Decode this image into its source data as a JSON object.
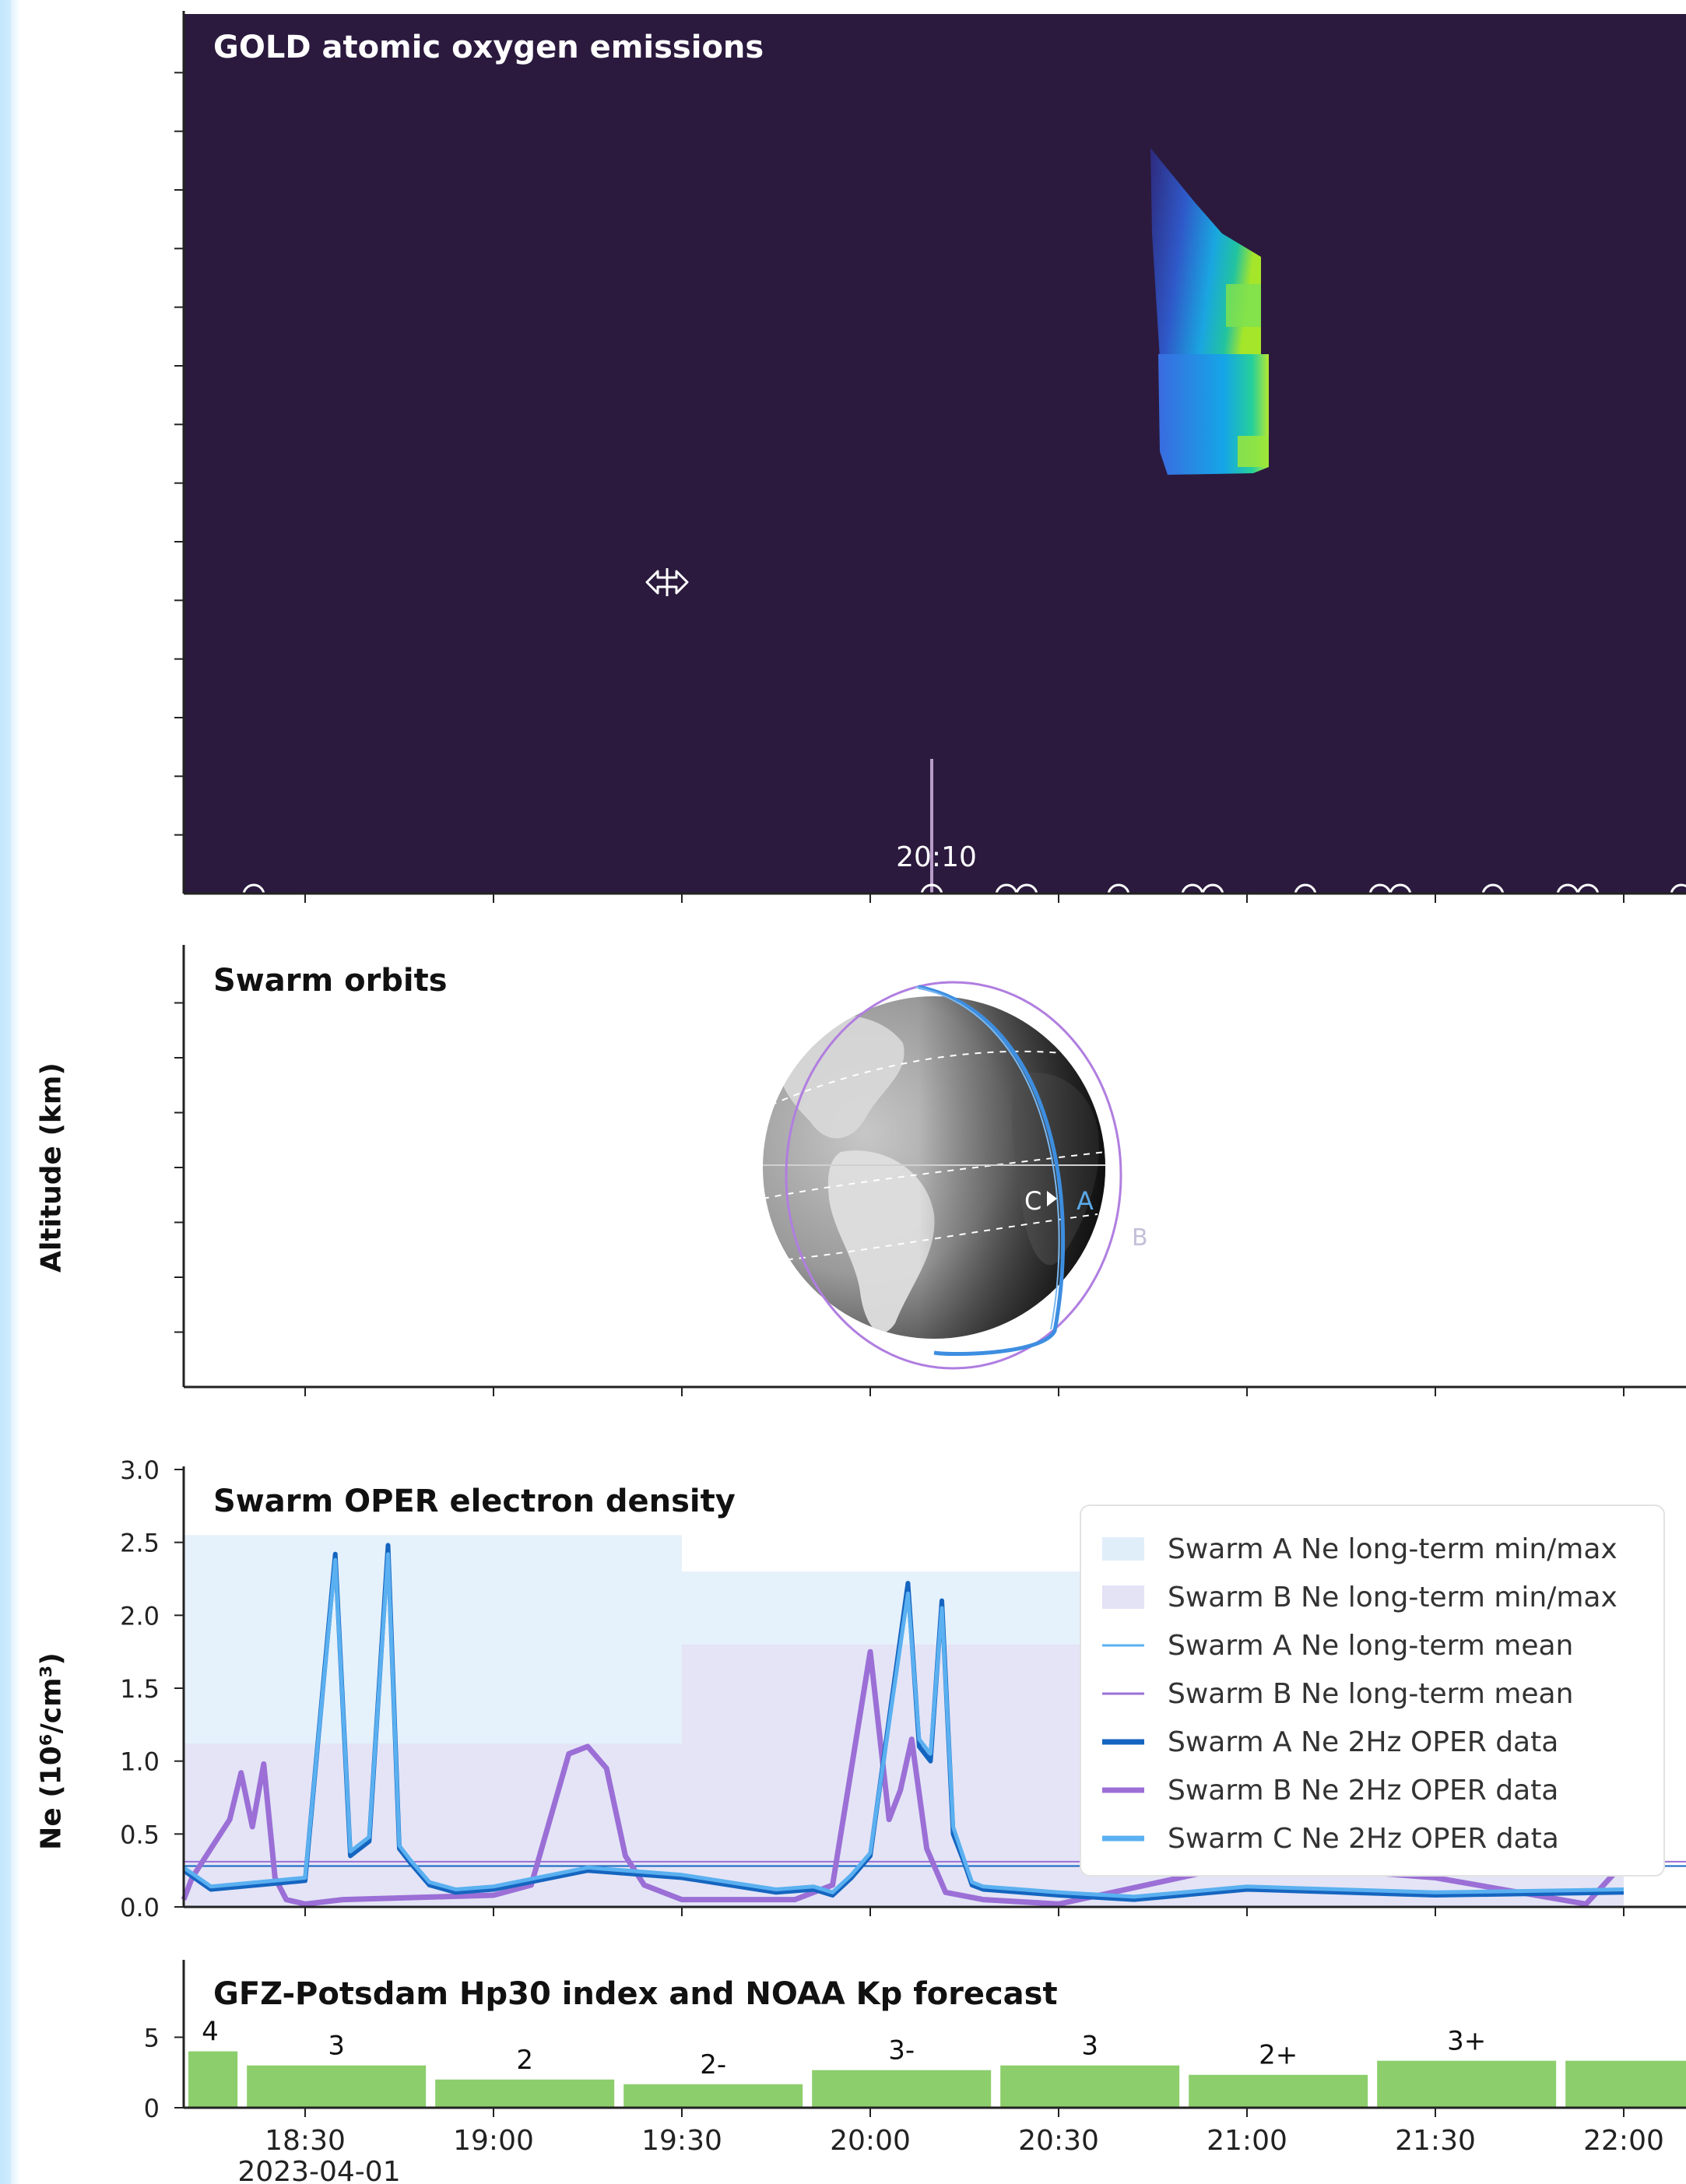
{
  "panels": {
    "gold": {
      "title": "GOLD atomic oxygen emissions",
      "cursor_time": "20:10"
    },
    "orbits": {
      "title": "Swarm orbits",
      "ylabel": "Altitude (km)",
      "sat_labels": [
        "C",
        "A",
        "B"
      ]
    },
    "ne": {
      "title": "Swarm OPER electron density",
      "ylabel": "Ne (10⁶/cm³)"
    },
    "hp": {
      "title": "GFZ-Potsdam Hp30 index and NOAA Kp forecast"
    }
  },
  "time_axis": {
    "ticks": [
      "18:30",
      "19:00",
      "19:30",
      "20:00",
      "20:30",
      "21:00",
      "21:30",
      "22:00"
    ],
    "date_label": "2023-04-01"
  },
  "colors": {
    "gold_bg": "#2b1a3e",
    "swarm_a": "#1565c0",
    "swarm_b": "#9b6fd6",
    "swarm_c": "#5ab0f0",
    "band_a": "#e0eefa",
    "band_b": "#e4e2f5",
    "hp_bar": "#8cce6c"
  },
  "chart_data": [
    {
      "type": "heatmap",
      "title": "GOLD atomic oxygen emissions",
      "colormap": "viridis",
      "background": "#2b1a3e"
    },
    {
      "type": "line",
      "title": "Swarm OPER electron density",
      "ylabel": "Ne (10⁶/cm³)",
      "ylim": [
        0,
        3.0
      ],
      "yticks": [
        "0.0",
        "0.5",
        "1.0",
        "1.5",
        "2.0",
        "2.5",
        "3.0"
      ],
      "x_hours": [
        18.083,
        19.5,
        22.0
      ],
      "bands": [
        {
          "name": "Swarm A Ne long-term min/max",
          "segments": [
            {
              "x0": 18.083,
              "x1": 19.5,
              "min": 0.0,
              "max": 2.55
            },
            {
              "x0": 19.5,
              "x1": 22.0,
              "min": 0.0,
              "max": 2.3
            }
          ]
        },
        {
          "name": "Swarm B Ne long-term min/max",
          "segments": [
            {
              "x0": 18.083,
              "x1": 19.5,
              "min": 0.0,
              "max": 1.12
            },
            {
              "x0": 19.5,
              "x1": 22.0,
              "min": 0.0,
              "max": 1.8
            }
          ]
        }
      ],
      "mean_lines": [
        {
          "name": "Swarm A Ne long-term mean",
          "value": 0.28
        },
        {
          "name": "Swarm B Ne long-term mean",
          "value": 0.31
        }
      ],
      "series": [
        {
          "name": "Swarm A Ne 2Hz OPER data",
          "color_key": "swarm_a",
          "x": [
            18.083,
            18.25,
            18.5,
            18.58,
            18.62,
            18.67,
            18.72,
            18.75,
            18.78,
            18.83,
            18.9,
            19.0,
            19.25,
            19.5,
            19.75,
            19.85,
            19.9,
            19.95,
            20.0,
            20.1,
            20.13,
            20.16,
            20.19,
            20.22,
            20.25,
            20.27,
            20.3,
            20.4,
            20.5,
            20.7,
            21.0,
            21.5,
            22.0
          ],
          "y": [
            0.25,
            0.12,
            0.18,
            2.42,
            0.35,
            0.45,
            2.48,
            0.4,
            0.3,
            0.15,
            0.1,
            0.12,
            0.25,
            0.2,
            0.1,
            0.12,
            0.08,
            0.2,
            0.35,
            2.22,
            1.1,
            1.0,
            2.1,
            0.5,
            0.3,
            0.15,
            0.12,
            0.1,
            0.08,
            0.05,
            0.12,
            0.08,
            0.1
          ]
        },
        {
          "name": "Swarm B Ne 2Hz OPER data",
          "color_key": "swarm_b",
          "x": [
            18.083,
            18.2,
            18.3,
            18.33,
            18.36,
            18.39,
            18.42,
            18.45,
            18.5,
            18.6,
            19.0,
            19.1,
            19.2,
            19.25,
            19.3,
            19.35,
            19.4,
            19.5,
            19.8,
            19.9,
            20.0,
            20.05,
            20.08,
            20.11,
            20.15,
            20.2,
            20.3,
            20.5,
            21.0,
            21.5,
            21.9,
            22.0
          ],
          "y": [
            0.05,
            0.2,
            0.6,
            0.92,
            0.55,
            0.98,
            0.2,
            0.05,
            0.02,
            0.05,
            0.08,
            0.15,
            1.05,
            1.1,
            0.95,
            0.35,
            0.15,
            0.05,
            0.05,
            0.15,
            1.75,
            0.6,
            0.8,
            1.15,
            0.4,
            0.1,
            0.05,
            0.02,
            0.3,
            0.2,
            0.02,
            0.3
          ]
        },
        {
          "name": "Swarm C Ne 2Hz OPER data",
          "color_key": "swarm_c",
          "x": [
            18.083,
            18.25,
            18.5,
            18.58,
            18.62,
            18.67,
            18.72,
            18.75,
            18.78,
            18.83,
            18.9,
            19.0,
            19.25,
            19.5,
            19.75,
            19.85,
            19.9,
            19.95,
            20.0,
            20.1,
            20.13,
            20.16,
            20.19,
            20.22,
            20.25,
            20.27,
            20.3,
            20.4,
            20.5,
            20.7,
            21.0,
            21.5,
            22.0
          ],
          "y": [
            0.27,
            0.14,
            0.2,
            2.38,
            0.38,
            0.48,
            2.42,
            0.42,
            0.32,
            0.17,
            0.12,
            0.14,
            0.27,
            0.22,
            0.12,
            0.14,
            0.1,
            0.22,
            0.37,
            2.15,
            1.15,
            1.05,
            2.05,
            0.55,
            0.32,
            0.17,
            0.14,
            0.12,
            0.1,
            0.07,
            0.14,
            0.1,
            0.12
          ]
        }
      ],
      "legend": {
        "placement": "top-right",
        "entries": [
          {
            "label": "Swarm A Ne long-term min/max",
            "kind": "box",
            "color_key": "band_a"
          },
          {
            "label": "Swarm B Ne long-term min/max",
            "kind": "box",
            "color_key": "band_b"
          },
          {
            "label": "Swarm A Ne long-term mean",
            "kind": "thin",
            "color_key": "swarm_c"
          },
          {
            "label": "Swarm B Ne long-term mean",
            "kind": "thin",
            "color_key": "swarm_b"
          },
          {
            "label": "Swarm A Ne 2Hz OPER data",
            "kind": "thick",
            "color_key": "swarm_a"
          },
          {
            "label": "Swarm B Ne 2Hz OPER data",
            "kind": "thick",
            "color_key": "swarm_b"
          },
          {
            "label": "Swarm C Ne 2Hz OPER data",
            "kind": "thick",
            "color_key": "swarm_c"
          }
        ]
      }
    },
    {
      "type": "bar",
      "title": "GFZ-Potsdam Hp30 index and NOAA Kp forecast",
      "ylim": [
        0,
        9
      ],
      "yticks": [
        "0",
        "5"
      ],
      "bars": [
        {
          "x0": 18.083,
          "x1": 18.333,
          "value": 4.0,
          "label": "4"
        },
        {
          "x0": 18.333,
          "x1": 18.833,
          "value": 3.0,
          "label": "3"
        },
        {
          "x0": 18.833,
          "x1": 19.333,
          "value": 2.0,
          "label": "2"
        },
        {
          "x0": 19.333,
          "x1": 19.833,
          "value": 1.667,
          "label": "2-"
        },
        {
          "x0": 19.833,
          "x1": 20.333,
          "value": 2.667,
          "label": "3-"
        },
        {
          "x0": 20.333,
          "x1": 20.833,
          "value": 3.0,
          "label": "3"
        },
        {
          "x0": 20.833,
          "x1": 21.333,
          "value": 2.333,
          "label": "2+"
        },
        {
          "x0": 21.333,
          "x1": 21.833,
          "value": 3.333,
          "label": "3+"
        },
        {
          "x0": 21.833,
          "x1": 22.3,
          "value": 3.333,
          "label": ""
        }
      ]
    }
  ]
}
